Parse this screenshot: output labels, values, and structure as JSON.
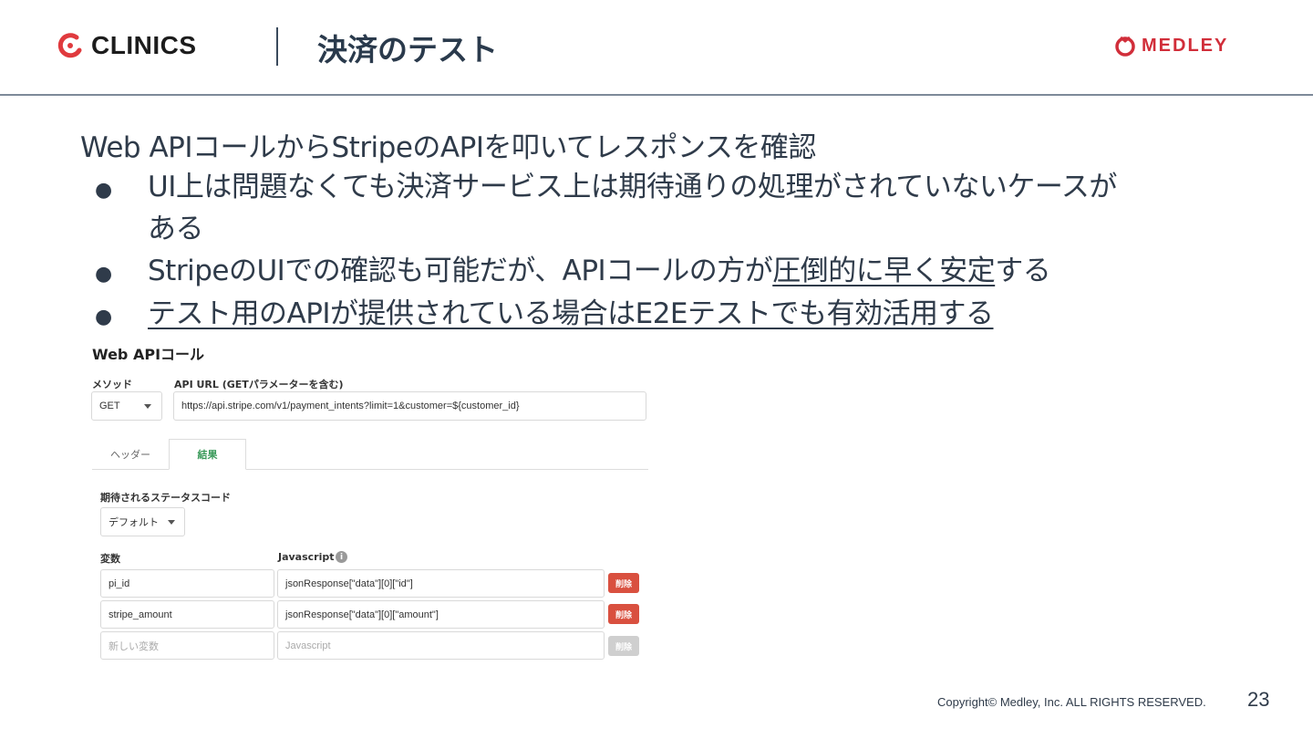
{
  "header": {
    "brand": "CLINICS",
    "title": "決済のテスト",
    "company": "MEDLEY",
    "colors": {
      "clinics_red": "#e03a3e",
      "medley_red": "#d12e3a",
      "text": "#2f3b4a"
    }
  },
  "body": {
    "lead": "Web APIコールからStripeのAPIを叩いてレスポンスを確認",
    "bullet_glyph": "●",
    "bullets": [
      {
        "line1": "UI上は問題なくても決済サービス上は期待通りの処理がされていないケースが",
        "line2": "ある"
      },
      {
        "text_before": "StripeのUIでの確認も可能だが、APIコールの方が",
        "text_underlined": "圧倒的に早く安定",
        "text_after": "する"
      },
      {
        "text_underlined": "テスト用のAPIが提供されている場合はE2Eテストでも有効活用する"
      }
    ]
  },
  "screenshot": {
    "title": "Web APIコール",
    "method_label": "メソッド",
    "method_value": "GET",
    "url_label": "API URL (GETパラメーターを含む)",
    "url_value": "https://api.stripe.com/v1/payment_intents?limit=1&customer=${customer_id}",
    "tabs": [
      "ヘッダー",
      "結果"
    ],
    "active_tab": "結果",
    "status_label": "期待されるステータスコード",
    "status_value": "デフォルト",
    "var_col_label": "変数",
    "js_col_label": "Javascript",
    "info_icon": "i",
    "rows": [
      {
        "var": "pi_id",
        "js": "jsonResponse[\"data\"][0][\"id\"]",
        "delete": "削除"
      },
      {
        "var": "stripe_amount",
        "js": "jsonResponse[\"data\"][0][\"amount\"]",
        "delete": "削除"
      }
    ],
    "new_row": {
      "var_placeholder": "新しい変数",
      "js_placeholder": "Javascript",
      "delete": "削除"
    },
    "colors": {
      "delete_active": "#d9503f",
      "delete_disabled": "#cfcfcf",
      "tab_active": "#3a9a5a"
    }
  },
  "footer": {
    "copyright": "Copyright© Medley, Inc. ALL RIGHTS RESERVED.",
    "page_number": "23"
  }
}
